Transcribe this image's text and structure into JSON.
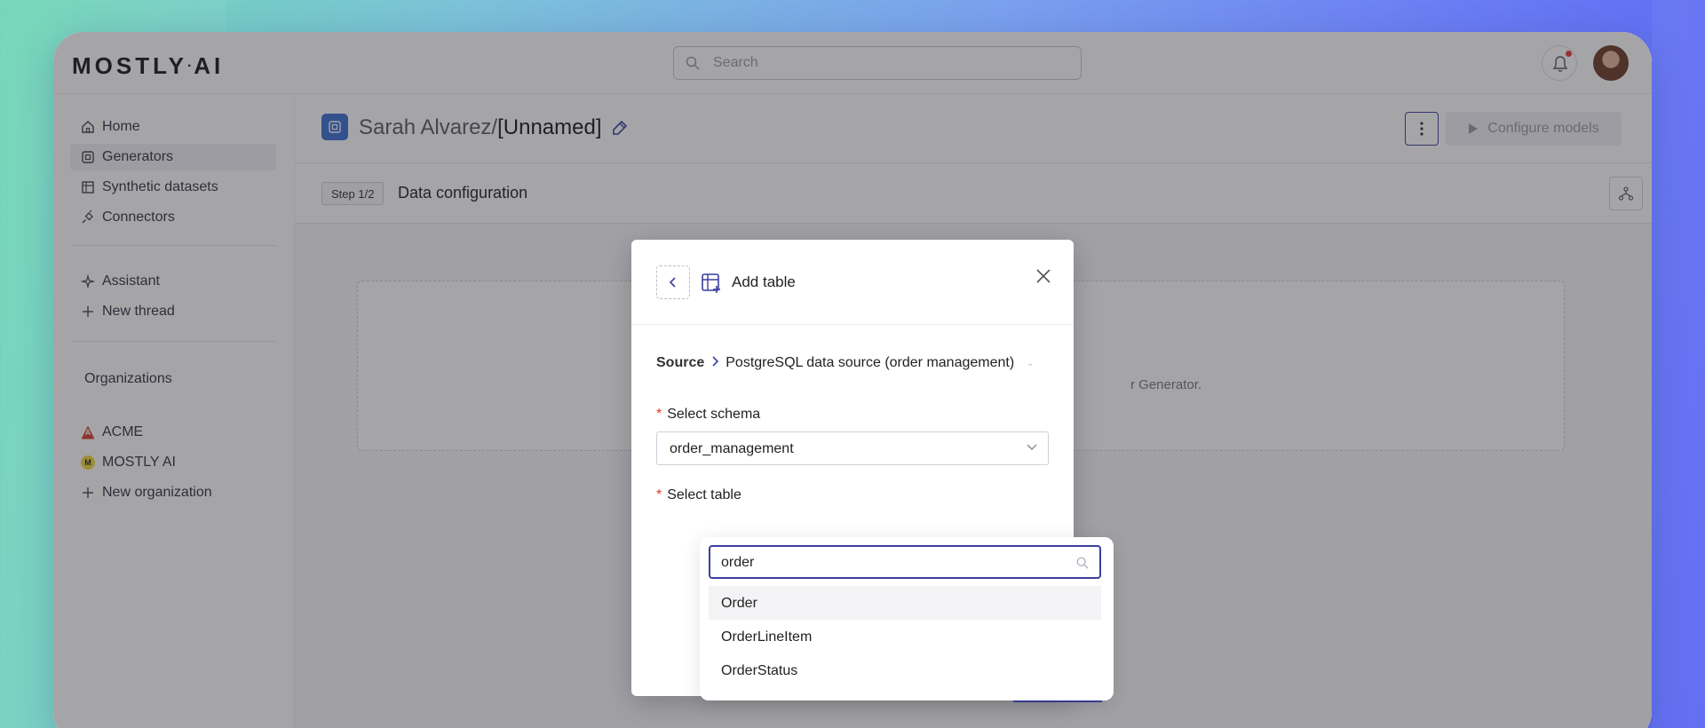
{
  "app": {
    "logo": {
      "left": "MOSTLY",
      "dot": "·",
      "right": "AI"
    },
    "search": {
      "placeholder": "Search"
    },
    "notifications": {
      "icon": "bell-icon",
      "has_unread": true
    },
    "user": {
      "avatar": "avatar"
    }
  },
  "sidebar": {
    "items": [
      {
        "label": "Home",
        "icon": "home-icon"
      },
      {
        "label": "Generators",
        "icon": "generator-icon",
        "active": true
      },
      {
        "label": "Synthetic datasets",
        "icon": "table-icon"
      },
      {
        "label": "Connectors",
        "icon": "plug-icon"
      }
    ],
    "assistant": [
      {
        "label": "Assistant",
        "icon": "sparkle-icon"
      },
      {
        "label": "New thread",
        "icon": "plus-icon"
      }
    ],
    "organizations_title": "Organizations",
    "organizations": [
      {
        "label": "ACME",
        "badge": "A",
        "color": "#d83b2d"
      },
      {
        "label": "MOSTLY AI",
        "badge": "M",
        "color": "#f0d83a"
      },
      {
        "label": "New organization",
        "icon": "plus-icon"
      }
    ]
  },
  "header": {
    "owner": "Sarah Alvarez/",
    "name": "[Unnamed]",
    "configure_label": "Configure models"
  },
  "subheader": {
    "step": "Step 1/2",
    "title": "Data configuration"
  },
  "background_text": "r Generator.",
  "modal": {
    "title": "Add table",
    "breadcrumb": {
      "source": "Source",
      "connector": "PostgreSQL data source (order management)"
    },
    "schema_label": "Select schema",
    "schema_value": "order_management",
    "table_label": "Select table",
    "table_search": "order",
    "options": [
      "Order",
      "OrderLineItem",
      "OrderStatus"
    ],
    "highlighted_option": "Order"
  },
  "colors": {
    "accent": "#3b3f9e",
    "generator_icon": "#3b6fd1",
    "required": "#d83b2d"
  }
}
